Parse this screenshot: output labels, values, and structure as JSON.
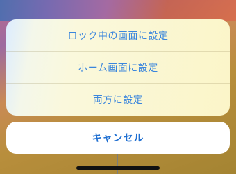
{
  "actions": [
    {
      "label": "ロック中の画面に設定"
    },
    {
      "label": "ホーム画面に設定"
    },
    {
      "label": "両方に設定"
    }
  ],
  "cancel": {
    "label": "キャンセル"
  },
  "colors": {
    "action_text": "#3a86dd",
    "cancel_text": "#1f6fd1"
  }
}
